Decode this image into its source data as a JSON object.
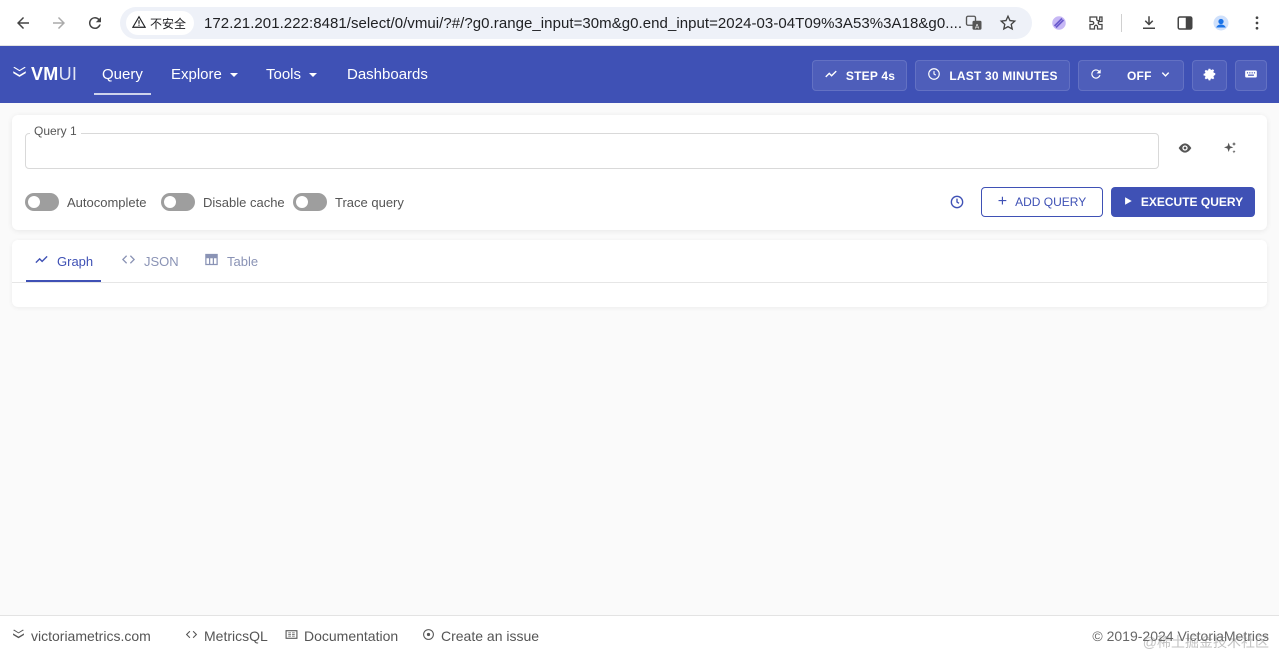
{
  "browser": {
    "security_label": "不安全",
    "url": "172.21.201.222:8481/select/0/vmui/?#/?g0.range_input=30m&g0.end_input=2024-03-04T09%3A53%3A18&g0...."
  },
  "header": {
    "logo_text": "VM",
    "logo_suffix": "UI",
    "menu": [
      "Query",
      "Explore",
      "Tools",
      "Dashboards"
    ],
    "step_label": "STEP 4s",
    "time_range_label": "LAST 30 MINUTES",
    "refresh_label": "OFF",
    "brand_color": "#3f51b5"
  },
  "query": {
    "label": "Query 1",
    "value": "",
    "toggles": [
      "Autocomplete",
      "Disable cache",
      "Trace query"
    ],
    "add_query_label": "ADD QUERY",
    "execute_label": "EXECUTE QUERY"
  },
  "tabs": [
    "Graph",
    "JSON",
    "Table"
  ],
  "footer": {
    "links": [
      "victoriametrics.com",
      "MetricsQL",
      "Documentation",
      "Create an issue"
    ],
    "copyright": "© 2019-2024 VictoriaMetrics",
    "watermark": "@稀土掘金技术社区"
  }
}
